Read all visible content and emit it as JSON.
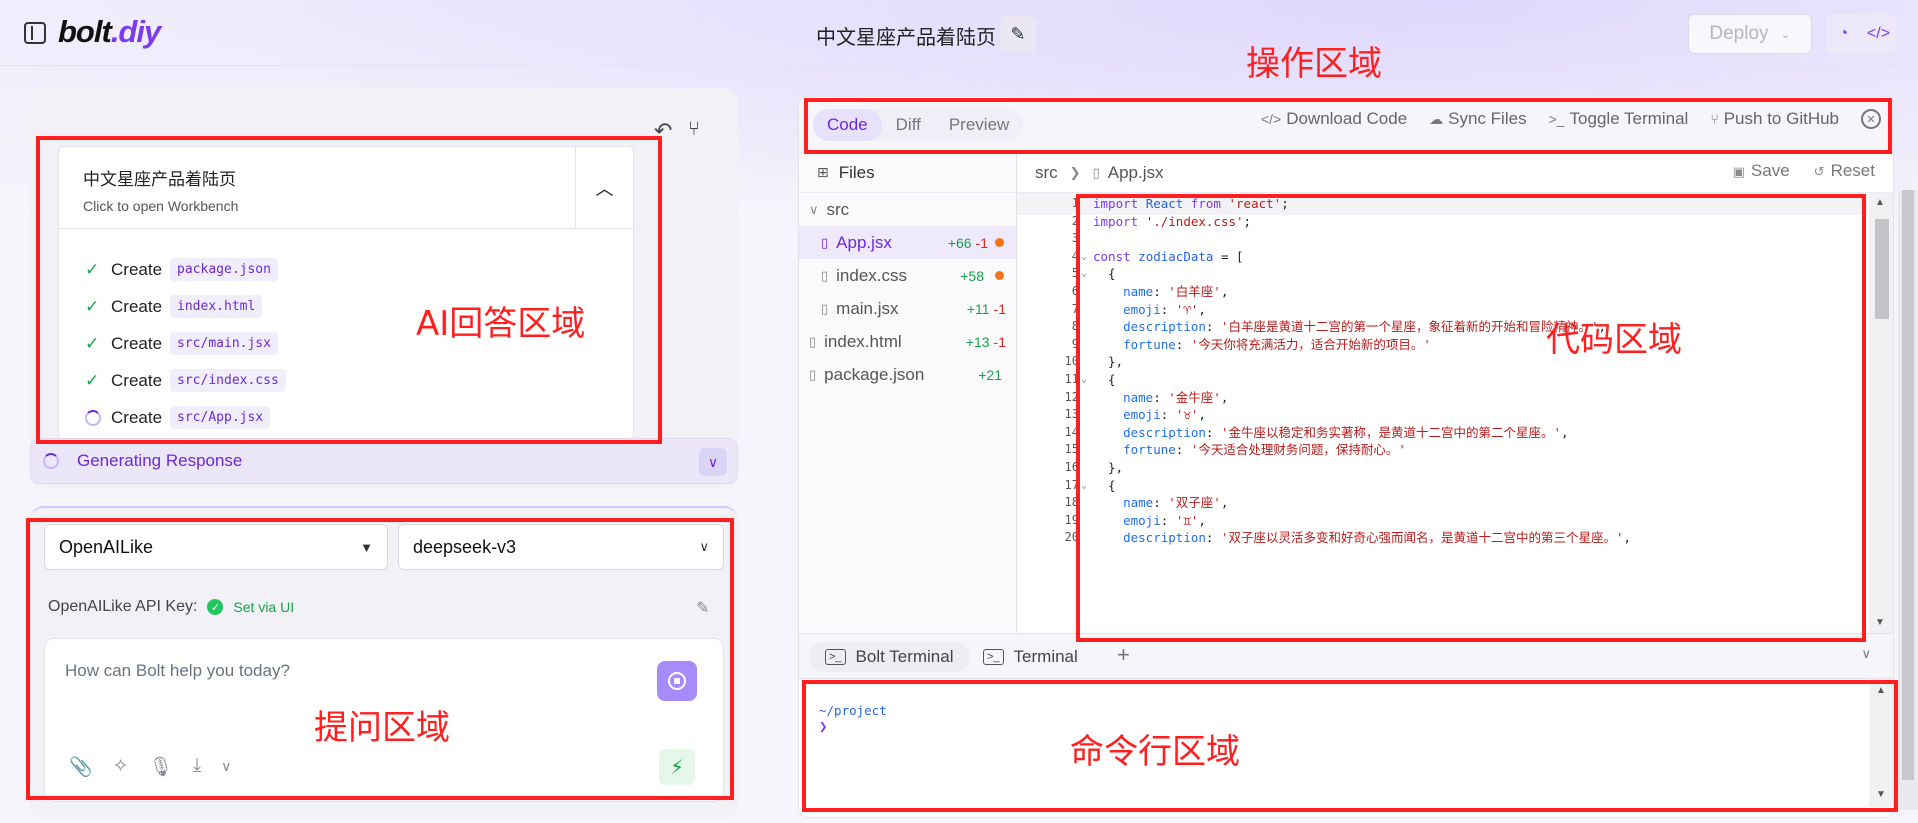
{
  "header": {
    "logo_main": "bolt",
    "logo_dot": ".diy",
    "project_title": "中文星座产品着陆页",
    "deploy_label": "Deploy"
  },
  "chat": {
    "artifact": {
      "title": "中文星座产品着陆页",
      "subtitle": "Click to open Workbench",
      "actions": [
        {
          "verb": "Create",
          "file": "package.json",
          "status": "done"
        },
        {
          "verb": "Create",
          "file": "index.html",
          "status": "done"
        },
        {
          "verb": "Create",
          "file": "src/main.jsx",
          "status": "done"
        },
        {
          "verb": "Create",
          "file": "src/index.css",
          "status": "done"
        },
        {
          "verb": "Create",
          "file": "src/App.jsx",
          "status": "running"
        }
      ]
    },
    "generating_label": "Generating Response"
  },
  "prompt": {
    "provider": "OpenAILike",
    "model": "deepseek-v3",
    "api_key_label": "OpenAILike API Key:",
    "api_key_status": "Set via UI",
    "placeholder": "How can Bolt help you today?"
  },
  "workbench": {
    "tabs": [
      "Code",
      "Diff",
      "Preview"
    ],
    "active_tab": "Code",
    "actions": {
      "download": "Download Code",
      "sync": "Sync Files",
      "toggle_terminal": "Toggle Terminal",
      "push": "Push to GitHub"
    },
    "files_label": "Files",
    "tree": {
      "folder": "src",
      "items": [
        {
          "name": "App.jsx",
          "add": "+66",
          "rem": "-1",
          "modified": true
        },
        {
          "name": "index.css",
          "add": "+58",
          "rem": "",
          "modified": true
        },
        {
          "name": "main.jsx",
          "add": "+11",
          "rem": "-1",
          "modified": false
        },
        {
          "name": "index.html",
          "add": "+13",
          "rem": "-1",
          "modified": false
        },
        {
          "name": "package.json",
          "add": "+21",
          "rem": "",
          "modified": false
        }
      ]
    },
    "breadcrumb": {
      "folder": "src",
      "file": "App.jsx"
    },
    "save_label": "Save",
    "reset_label": "Reset",
    "code_lines": [
      "import React from 'react';",
      "import './index.css';",
      "",
      "const zodiacData = [",
      "  {",
      "    name: '白羊座',",
      "    emoji: '♈',",
      "    description: '白羊座是黄道十二宫的第一个星座，象征着新的开始和冒险精神。',",
      "    fortune: '今天你将充满活力，适合开始新的项目。'",
      "  },",
      "  {",
      "    name: '金牛座',",
      "    emoji: '♉',",
      "    description: '金牛座以稳定和务实著称，是黄道十二宫中的第二个星座。',",
      "    fortune: '今天适合处理财务问题，保持耐心。'",
      "  },",
      "  {",
      "    name: '双子座',",
      "    emoji: '♊',",
      "    description: '双子座以灵活多变和好奇心强而闻名，是黄道十二宫中的第三个星座。',"
    ],
    "terminal": {
      "tabs": [
        "Bolt Terminal",
        "Terminal"
      ],
      "path": "~/project",
      "prompt_symbol": "❯"
    }
  },
  "annotations": {
    "ai_answer": "AI回答区域",
    "prompt": "提问区域",
    "operation": "操作区域",
    "code": "代码区域",
    "terminal": "命令行区域"
  },
  "colors": {
    "accent": "#7c3aed",
    "annotation": "#ff1f1f",
    "success": "#16a34a",
    "removed": "#dc2626",
    "modified_dot": "#f97316"
  }
}
